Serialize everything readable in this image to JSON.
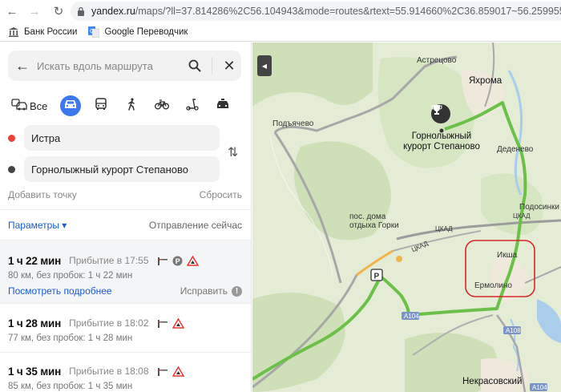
{
  "browser": {
    "url_host": "yandex.ru",
    "url_rest": "/maps/?ll=37.814286%2C56.104943&mode=routes&rtext=55.914660%2C36.859017~56.259955%2C37.4",
    "bookmarks": [
      {
        "label": "Банк России",
        "icon": "bank-icon"
      },
      {
        "label": "Google Переводчик",
        "icon": "translate-icon"
      }
    ]
  },
  "search": {
    "placeholder": "Искать вдоль маршрута"
  },
  "modes": {
    "all_label": "Все",
    "active": "car"
  },
  "waypoints": {
    "from": {
      "value": "Истра",
      "color": "#e8413c"
    },
    "to": {
      "value": "Горнолыжный курорт Степаново",
      "color": "#444444"
    }
  },
  "actions": {
    "add_point": "Добавить точку",
    "reset": "Сбросить"
  },
  "params": {
    "label": "Параметры ▾",
    "departure": "Отправление сейчас"
  },
  "routes": [
    {
      "time": "1 ч 22 мин",
      "arrival": "Прибытие в 17:55",
      "details": "80 км, без пробок: 1 ч 22 мин",
      "more": "Посмотреть подробнее",
      "fix": "Исправить",
      "info": "!"
    },
    {
      "time": "1 ч 28 мин",
      "arrival": "Прибытие в 18:02",
      "details": "77 км, без пробок: 1 ч 28 мин"
    },
    {
      "time": "1 ч 35 мин",
      "arrival": "Прибытие в 18:08",
      "details": "85 км, без пробок: 1 ч 35 мин"
    }
  ],
  "map": {
    "places": {
      "astretsovo": "Астрецово",
      "yakhroma": "Яхрома",
      "podyachevo": "Подъячево",
      "dedenevo": "Деденево",
      "podosinki": "Подосинки",
      "gorki": "пос. дома отдыха Горки",
      "iksha": "Икша",
      "ermolino": "Ермолино",
      "nekrasovsky": "Некрасовский"
    },
    "destination": "Горнолыжный курорт Степаново",
    "road_labels": {
      "ckad1": "ЦКАД",
      "ckad2": "ЦКАД",
      "ckad3": "ЦКАД",
      "a104": "А104",
      "a108": "А108",
      "a104b": "А104"
    },
    "colors": {
      "route": "#6cc04a",
      "highlight": "#d9262a",
      "forest": "#cfe0b8",
      "water": "#aacdec"
    }
  }
}
